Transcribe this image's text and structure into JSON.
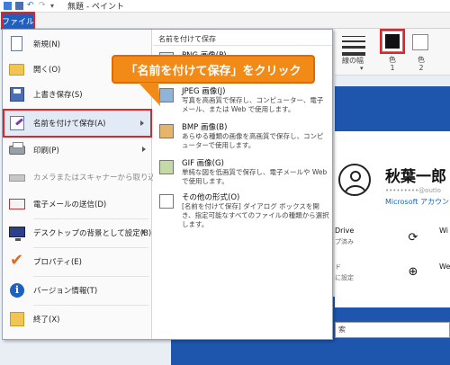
{
  "window": {
    "title": "無題 - ペイント"
  },
  "ribbon": {
    "file_tab": "ファイル",
    "line_width_label": "線の幅",
    "color1_label": "色\n1",
    "color2_label": "色\n2",
    "color1_value": "#111111",
    "color2_value": "#ffffff"
  },
  "file_menu": {
    "items": [
      {
        "label": "新規(N)"
      },
      {
        "label": "開く(O)"
      },
      {
        "label": "上書き保存(S)"
      },
      {
        "label": "名前を付けて保存(A)"
      },
      {
        "label": "印刷(P)"
      },
      {
        "label": "カメラまたはスキャナーから取り込み(M)"
      },
      {
        "label": "電子メールの送信(D)"
      },
      {
        "label": "デスクトップの背景として設定(B)"
      },
      {
        "label": "プロパティ(E)"
      },
      {
        "label": "バージョン情報(T)"
      },
      {
        "label": "終了(X)"
      }
    ]
  },
  "save_as_panel": {
    "header": "名前を付けて保存",
    "items": [
      {
        "title": "PNG 画像(P)",
        "desc": ""
      },
      {
        "title": "JPEG 画像(J)",
        "desc": "写真を高画質で保存し、コンピューター、電子メール、または Web で使用します。"
      },
      {
        "title": "BMP 画像(B)",
        "desc": "あらゆる種類の画像を高画質で保存し、コンピューターで使用します。"
      },
      {
        "title": "GIF 画像(G)",
        "desc": "単純な図を低画質で保存し、電子メールや Web で使用します。"
      },
      {
        "title": "その他の形式(O)",
        "desc": "[名前を付けて保存] ダイアログ ボックスを開き、指定可能なすべてのファイルの種類から選択します。"
      }
    ]
  },
  "callout": {
    "text": "「名前を付けて保存」をクリック"
  },
  "account_card": {
    "name": "秋葉一郎",
    "email": "@outlo",
    "link": "Microsoft アカウン",
    "onedrive_label": "Drive",
    "onedrive_sub": "プ済み",
    "sync_label": "Wi",
    "web_label": "We",
    "settings_sub": "ド",
    "storage_sub": "に設定"
  },
  "search": {
    "text": "索"
  }
}
